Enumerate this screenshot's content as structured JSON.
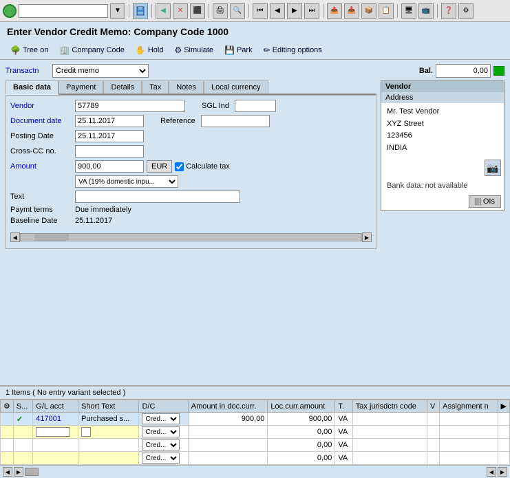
{
  "toolbar": {
    "status_indicator": "✓",
    "save_icon": "💾",
    "nav_icons": [
      "◀▶",
      "🔍",
      "✕",
      "🖨️",
      "📋"
    ],
    "right_icons": [
      "📤",
      "📥",
      "⚙️",
      "❓",
      "🖥️"
    ]
  },
  "title": "Enter Vendor Credit Memo: Company Code 1000",
  "menu": {
    "items": [
      {
        "id": "tree-on",
        "label": "Tree on",
        "icon": "🌲"
      },
      {
        "id": "company-code",
        "label": "Company Code",
        "icon": "🏢"
      },
      {
        "id": "hold",
        "label": "Hold",
        "icon": "✋"
      },
      {
        "id": "simulate",
        "label": "Simulate",
        "icon": "⚙️"
      },
      {
        "id": "park",
        "label": "Park",
        "icon": "💾"
      },
      {
        "id": "editing-options",
        "label": "Editing options",
        "icon": "✏️"
      }
    ]
  },
  "form": {
    "transactn_label": "Transactn",
    "transactn_value": "Credit memo",
    "bal_label": "Bal.",
    "bal_value": "0,00",
    "tabs": [
      {
        "id": "basic-data",
        "label": "Basic data",
        "active": true
      },
      {
        "id": "payment",
        "label": "Payment"
      },
      {
        "id": "details",
        "label": "Details"
      },
      {
        "id": "tax",
        "label": "Tax"
      },
      {
        "id": "notes",
        "label": "Notes"
      },
      {
        "id": "local-currency",
        "label": "Local currency"
      }
    ],
    "fields": {
      "vendor_label": "Vendor",
      "vendor_value": "57789",
      "sgl_ind_label": "SGL Ind",
      "sgl_ind_value": "",
      "document_date_label": "Document date",
      "document_date_value": "25.11.2017",
      "reference_label": "Reference",
      "reference_value": "",
      "posting_date_label": "Posting Date",
      "posting_date_value": "25.11.2017",
      "cross_cc_label": "Cross-CC no.",
      "cross_cc_value": "",
      "amount_label": "Amount",
      "amount_value": "900,00",
      "currency": "EUR",
      "calculate_tax_label": "Calculate tax",
      "tax_code_value": "VA (19% domestic inpu...",
      "text_label": "Text",
      "text_value": "",
      "paymt_terms_label": "Paymt terms",
      "paymt_terms_value": "Due immediately",
      "baseline_date_label": "Baseline Date",
      "baseline_date_value": "25.11.2017"
    },
    "vendor_panel": {
      "vendor_title": "Vendor",
      "address_title": "Address",
      "name": "Mr. Test Vendor",
      "street": "XYZ Street",
      "postal": "123456",
      "country": "INDIA",
      "bank_data": "Bank data: not available",
      "ois_label": "OIs"
    }
  },
  "items": {
    "header": "1 Items ( No entry variant selected )",
    "columns": [
      {
        "id": "status",
        "label": "S..."
      },
      {
        "id": "gl-acct",
        "label": "G/L acct"
      },
      {
        "id": "short-text",
        "label": "Short Text"
      },
      {
        "id": "dc",
        "label": "D/C"
      },
      {
        "id": "amount",
        "label": "Amount in doc.curr."
      },
      {
        "id": "loc-amount",
        "label": "Loc.curr.amount"
      },
      {
        "id": "t",
        "label": "T."
      },
      {
        "id": "tax-jur",
        "label": "Tax jurisdctn code"
      },
      {
        "id": "v",
        "label": "V"
      },
      {
        "id": "assignment",
        "label": "Assignment n"
      }
    ],
    "rows": [
      {
        "status": "✓",
        "status_color": "green",
        "gl_acct": "417001",
        "short_text": "Purchased s...",
        "dc": "Cred...",
        "amount": "900,00",
        "loc_amount": "900,00",
        "t": "VA",
        "tax_jur": "",
        "v": "",
        "assignment": "",
        "row_type": "data"
      },
      {
        "status": "",
        "status_color": "",
        "gl_acct": "",
        "short_text": "",
        "dc": "Cred...",
        "amount": "",
        "loc_amount": "0,00",
        "t": "VA",
        "tax_jur": "",
        "v": "",
        "assignment": "",
        "row_type": "yellow"
      },
      {
        "status": "",
        "status_color": "",
        "gl_acct": "",
        "short_text": "",
        "dc": "Cred...",
        "amount": "",
        "loc_amount": "0,00",
        "t": "VA",
        "tax_jur": "",
        "v": "",
        "assignment": "",
        "row_type": "normal"
      },
      {
        "status": "",
        "status_color": "",
        "gl_acct": "",
        "short_text": "",
        "dc": "Cred...",
        "amount": "",
        "loc_amount": "0,00",
        "t": "VA",
        "tax_jur": "",
        "v": "",
        "assignment": "",
        "row_type": "yellow"
      }
    ]
  }
}
